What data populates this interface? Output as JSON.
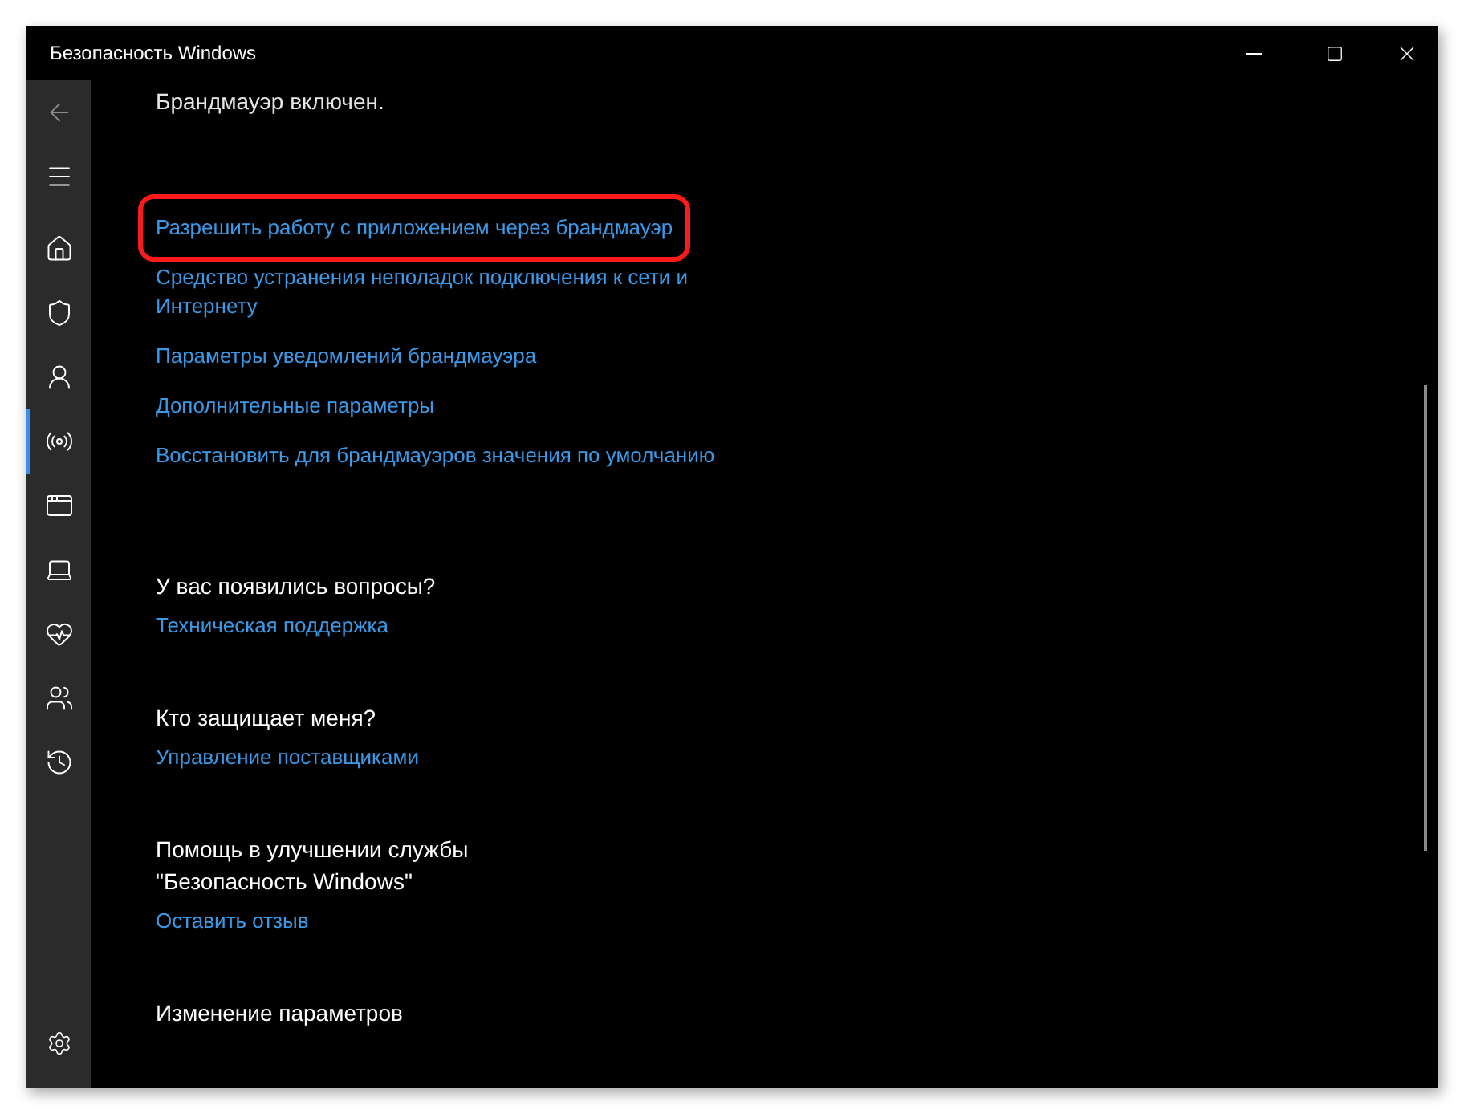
{
  "window": {
    "title": "Безопасность Windows"
  },
  "sidebar": {
    "items": [
      {
        "kind": "home",
        "selected": false
      },
      {
        "kind": "shield",
        "selected": false
      },
      {
        "kind": "account",
        "selected": false
      },
      {
        "kind": "network",
        "selected": true
      },
      {
        "kind": "app",
        "selected": false
      },
      {
        "kind": "device",
        "selected": false
      },
      {
        "kind": "health",
        "selected": false
      },
      {
        "kind": "family",
        "selected": false
      },
      {
        "kind": "history",
        "selected": false
      }
    ]
  },
  "status": "Брандмауэр включен.",
  "links": [
    {
      "text": "Разрешить работу с приложением через брандмауэр",
      "highlighted": true
    },
    {
      "text": "Средство устранения неполадок подключения к сети и Интернету",
      "highlighted": false
    },
    {
      "text": "Параметры уведомлений брандмауэра",
      "highlighted": false
    },
    {
      "text": "Дополнительные параметры",
      "highlighted": false
    },
    {
      "text": "Восстановить для брандмауэров значения по умолчанию",
      "highlighted": false
    }
  ],
  "sections": [
    {
      "heading": "У вас появились вопросы?",
      "link": "Техническая поддержка"
    },
    {
      "heading": "Кто защищает меня?",
      "link": "Управление поставщиками"
    },
    {
      "heading": "Помощь в улучшении службы \"Безопасность Windows\"",
      "link": "Оставить отзыв"
    },
    {
      "heading": "Изменение параметров"
    }
  ]
}
